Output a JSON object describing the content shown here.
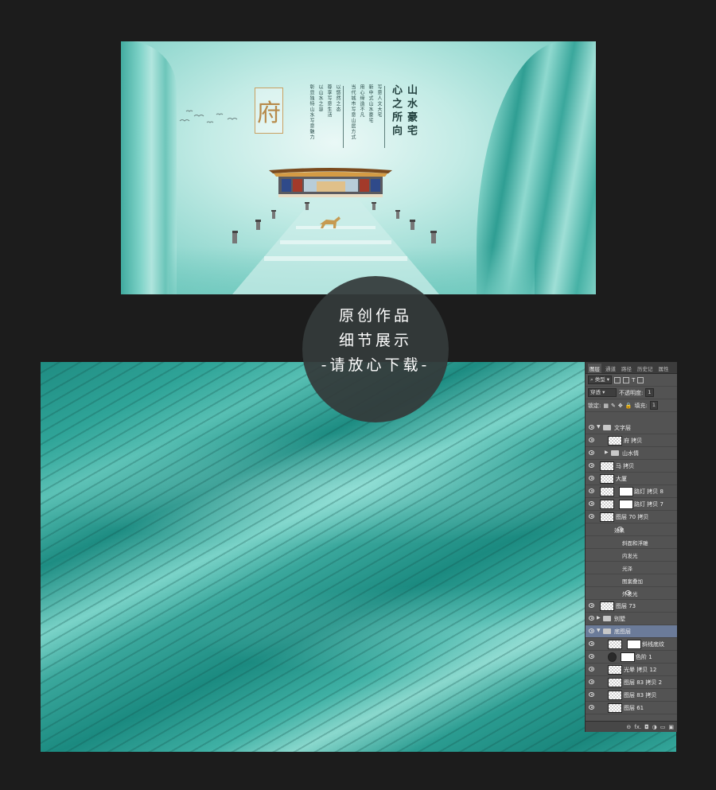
{
  "poster": {
    "fu_char": "府",
    "headline_col1": "山水豪宅",
    "headline_col2": "心之所向",
    "copy_cols": [
      "写意人文大宅",
      "新中式山水豪宅",
      "用心缔造不凡",
      "当代城市写意山居方式",
      "以悠然之态",
      "尊享写意生活",
      "以山水之容",
      "彰显独特山水写意魅力"
    ]
  },
  "overlay": {
    "line1": "原创作品",
    "line2": "细节展示",
    "line3": "-请放心下载-"
  },
  "layers_panel": {
    "tabs": [
      "图层",
      "通道",
      "路径",
      "历史记",
      "属性"
    ],
    "filter_label": "类型",
    "blend_mode": "穿透",
    "opacity_label": "不透明度:",
    "opacity_value": "1",
    "lock_label": "锁定:",
    "fill_label": "填充:",
    "fill_value": "1",
    "layers": [
      {
        "name": "文字层",
        "kind": "group-open",
        "indent": 0
      },
      {
        "name": "府 拷贝",
        "kind": "layer",
        "indent": 1
      },
      {
        "name": "山水情",
        "kind": "group",
        "indent": 1
      },
      {
        "name": "马 拷贝",
        "kind": "layer",
        "indent": 0
      },
      {
        "name": "大厦",
        "kind": "layer",
        "indent": 0
      },
      {
        "name": "路灯 拷贝 8",
        "kind": "masked",
        "indent": 0
      },
      {
        "name": "路灯 拷贝 7",
        "kind": "masked",
        "indent": 0
      },
      {
        "name": "图层 70 拷贝",
        "kind": "layer",
        "indent": 0
      },
      {
        "name": "效果",
        "kind": "fx",
        "indent": 1
      },
      {
        "name": "斜面和浮雕",
        "kind": "fx-item",
        "indent": 2
      },
      {
        "name": "内发光",
        "kind": "fx-item",
        "indent": 2
      },
      {
        "name": "光泽",
        "kind": "fx-item",
        "indent": 2
      },
      {
        "name": "图案叠加",
        "kind": "fx-item",
        "indent": 2
      },
      {
        "name": "外发光",
        "kind": "fx-item",
        "indent": 2
      },
      {
        "name": "图层 73",
        "kind": "layer",
        "indent": 0
      },
      {
        "name": "别墅",
        "kind": "group",
        "indent": 0
      },
      {
        "name": "底图层",
        "kind": "group-open",
        "indent": 0,
        "selected": true
      },
      {
        "name": "斜线底纹",
        "kind": "masked",
        "indent": 1
      },
      {
        "name": "色阶 1",
        "kind": "adjust",
        "indent": 1
      },
      {
        "name": "光晕 拷贝 12",
        "kind": "layer",
        "indent": 1
      },
      {
        "name": "图层 83 拷贝 2",
        "kind": "layer",
        "indent": 1
      },
      {
        "name": "图层 83 拷贝",
        "kind": "layer",
        "indent": 1
      },
      {
        "name": "图层 61",
        "kind": "layer",
        "indent": 1
      }
    ],
    "bottom_icons": [
      "⊖",
      "fx.",
      "◘",
      "◑",
      "▭",
      "▣"
    ]
  }
}
